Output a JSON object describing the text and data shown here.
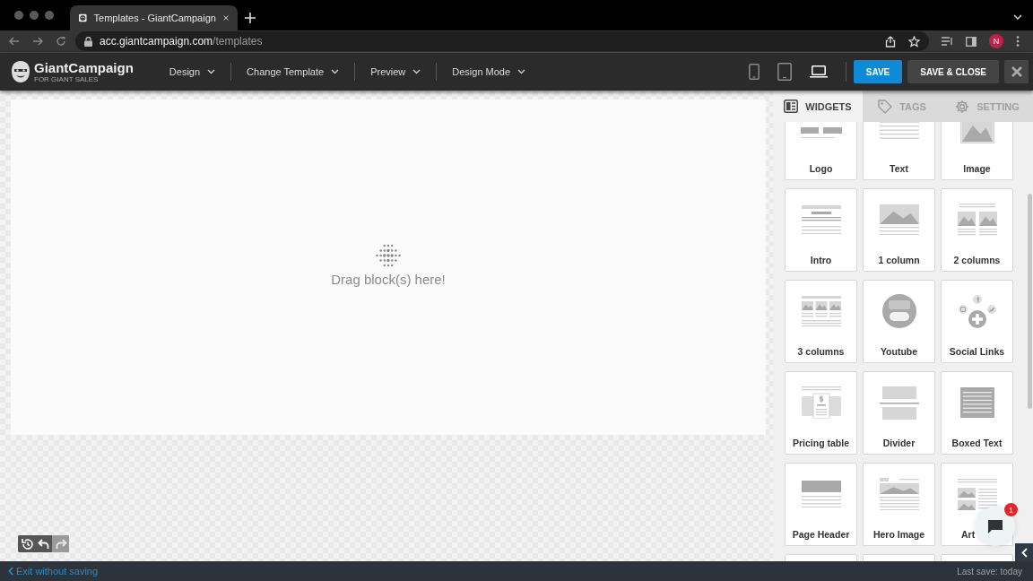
{
  "browser": {
    "tab_title": "Templates - GiantCampaign",
    "url_host": "acc.giantcampaign.com",
    "url_path": "/templates",
    "profile_initial": "N"
  },
  "app": {
    "logo": "GiantCampaign",
    "logo_tagline": "FOR GIANT SALES",
    "menus": [
      {
        "label": "Design"
      },
      {
        "label": "Change Template"
      },
      {
        "label": "Preview"
      },
      {
        "label": "Design Mode"
      }
    ],
    "devices": [
      {
        "kind": "phone",
        "selected": false
      },
      {
        "kind": "tablet",
        "selected": false
      },
      {
        "kind": "laptop",
        "selected": true
      }
    ],
    "save_button": "SAVE",
    "save_close_button": "SAVE & CLOSE"
  },
  "canvas": {
    "drop_hint": "Drag block(s) here!"
  },
  "history_toolbar": [
    {
      "kind": "history",
      "disabled": false
    },
    {
      "kind": "undo",
      "disabled": false
    },
    {
      "kind": "redo",
      "disabled": true
    }
  ],
  "sidebar": {
    "tabs": [
      {
        "label": "WIDGETS",
        "selected": true
      },
      {
        "label": "TAGS",
        "selected": false
      },
      {
        "label": "SETTING",
        "selected": false
      }
    ],
    "widgets": [
      {
        "label": "Logo",
        "kind": "logo"
      },
      {
        "label": "Text",
        "kind": "text"
      },
      {
        "label": "Image",
        "kind": "image"
      },
      {
        "label": "Intro",
        "kind": "intro"
      },
      {
        "label": "1 column",
        "kind": "column1"
      },
      {
        "label": "2 columns",
        "kind": "columns2"
      },
      {
        "label": "3 columns",
        "kind": "columns3"
      },
      {
        "label": "Youtube",
        "kind": "youtube"
      },
      {
        "label": "Social Links",
        "kind": "social"
      },
      {
        "label": "Pricing table",
        "kind": "pricing"
      },
      {
        "label": "Divider",
        "kind": "divider"
      },
      {
        "label": "Boxed Text",
        "kind": "boxed"
      },
      {
        "label": "Page Header",
        "kind": "pageheader"
      },
      {
        "label": "Hero Image",
        "kind": "hero"
      },
      {
        "label": "Art",
        "kind": "article"
      },
      {
        "kind": "blank"
      },
      {
        "kind": "blank"
      },
      {
        "kind": "blank"
      }
    ]
  },
  "chat": {
    "badge": "1"
  },
  "status_bar": {
    "exit_link": "Exit without saving",
    "last_save": "Last save: today"
  }
}
